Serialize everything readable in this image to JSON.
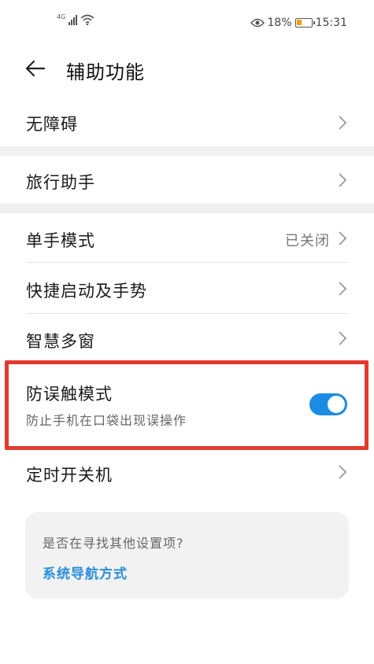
{
  "status_bar": {
    "network": "4G",
    "battery_percent": "18%",
    "time": "15:31",
    "battery_level": 0.18,
    "icons": [
      "signal-icon",
      "wifi-icon",
      "eye-comfort-icon",
      "battery-icon"
    ]
  },
  "header": {
    "title": "辅助功能"
  },
  "rows": {
    "accessibility": {
      "label": "无障碍"
    },
    "travel_assistant": {
      "label": "旅行助手"
    },
    "one_hand": {
      "label": "单手模式",
      "value": "已关闭"
    },
    "quick_launch": {
      "label": "快捷启动及手势"
    },
    "smart_multi_window": {
      "label": "智慧多窗"
    },
    "accidental_touch": {
      "label": "防误触模式",
      "subtitle": "防止手机在口袋出现误操作",
      "enabled": true
    },
    "scheduled_power": {
      "label": "定时开关机"
    }
  },
  "suggest": {
    "title": "是否在寻找其他设置项?",
    "link": "系统导航方式"
  },
  "colors": {
    "accent": "#1a8ce3",
    "highlight": "#e23a2e",
    "link": "#2a8ed8"
  }
}
